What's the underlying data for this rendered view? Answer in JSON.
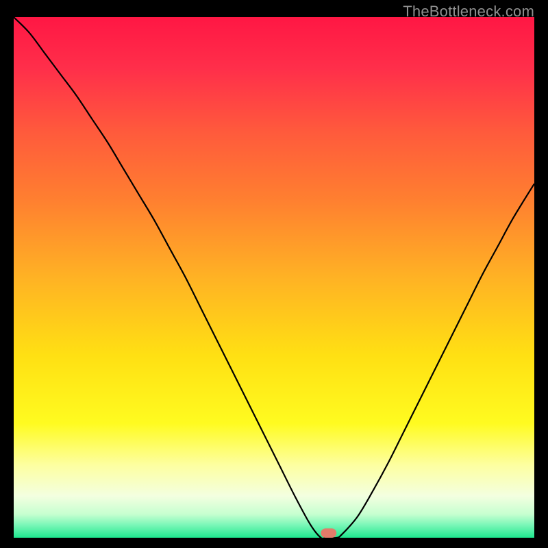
{
  "watermark": "TheBottleneck.com",
  "colors": {
    "frame_bg": "#000000",
    "curve": "#000000",
    "marker": "#e37b6a"
  },
  "chart_data": {
    "type": "line",
    "title": "",
    "xlabel": "",
    "ylabel": "",
    "x_range": [
      0,
      100
    ],
    "y_range": [
      0,
      100
    ],
    "gradient": [
      {
        "offset": 0.0,
        "color": "#ff1744"
      },
      {
        "offset": 0.1,
        "color": "#ff2f4a"
      },
      {
        "offset": 0.22,
        "color": "#ff5a3c"
      },
      {
        "offset": 0.35,
        "color": "#ff7f30"
      },
      {
        "offset": 0.5,
        "color": "#ffb224"
      },
      {
        "offset": 0.65,
        "color": "#ffe013"
      },
      {
        "offset": 0.78,
        "color": "#fffb20"
      },
      {
        "offset": 0.86,
        "color": "#fdffa0"
      },
      {
        "offset": 0.92,
        "color": "#f3ffe0"
      },
      {
        "offset": 0.955,
        "color": "#c6ffd0"
      },
      {
        "offset": 0.975,
        "color": "#7cf7b8"
      },
      {
        "offset": 1.0,
        "color": "#1ee88f"
      }
    ],
    "x": [
      0,
      3,
      6,
      9,
      12,
      15,
      18,
      21,
      24,
      27,
      30,
      33,
      36,
      39,
      42,
      45,
      48,
      51,
      54,
      57,
      59,
      60,
      62,
      63,
      66,
      69,
      72,
      75,
      78,
      81,
      84,
      87,
      90,
      93,
      96,
      100
    ],
    "values": [
      100,
      97,
      93,
      89,
      85,
      80.5,
      76,
      71,
      66,
      61,
      55.5,
      50,
      44,
      38,
      32,
      26,
      20,
      14,
      8,
      2.5,
      0,
      0,
      0,
      0.6,
      4,
      9,
      14.5,
      20.5,
      26.5,
      32.5,
      38.5,
      44.5,
      50.5,
      56,
      61.5,
      68
    ],
    "marker": {
      "x": 60.5,
      "width": 3.0,
      "height": 1.8
    }
  }
}
